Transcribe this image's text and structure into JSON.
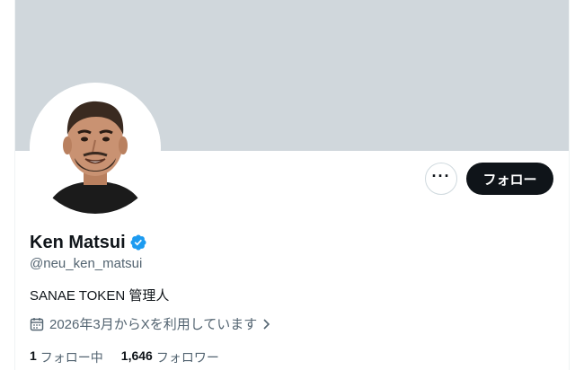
{
  "profile": {
    "display_name": "Ken Matsui",
    "handle": "@neu_ken_matsui",
    "bio": "SANAE TOKEN 管理人",
    "joined": "2026年3月からXを利用しています",
    "verified": true
  },
  "actions": {
    "more_label": "···",
    "follow_label": "フォロー"
  },
  "stats": {
    "following_count": "1",
    "following_label": "フォロー中",
    "followers_count": "1,646",
    "followers_label": "フォロワー"
  },
  "colors": {
    "banner": "#d0d7dc",
    "verified_badge": "#1d9bf0",
    "follow_button_bg": "#0f1419",
    "secondary_text": "#536471"
  },
  "icons": [
    "more-icon",
    "verified-badge-icon",
    "calendar-icon",
    "chevron-right-icon"
  ]
}
